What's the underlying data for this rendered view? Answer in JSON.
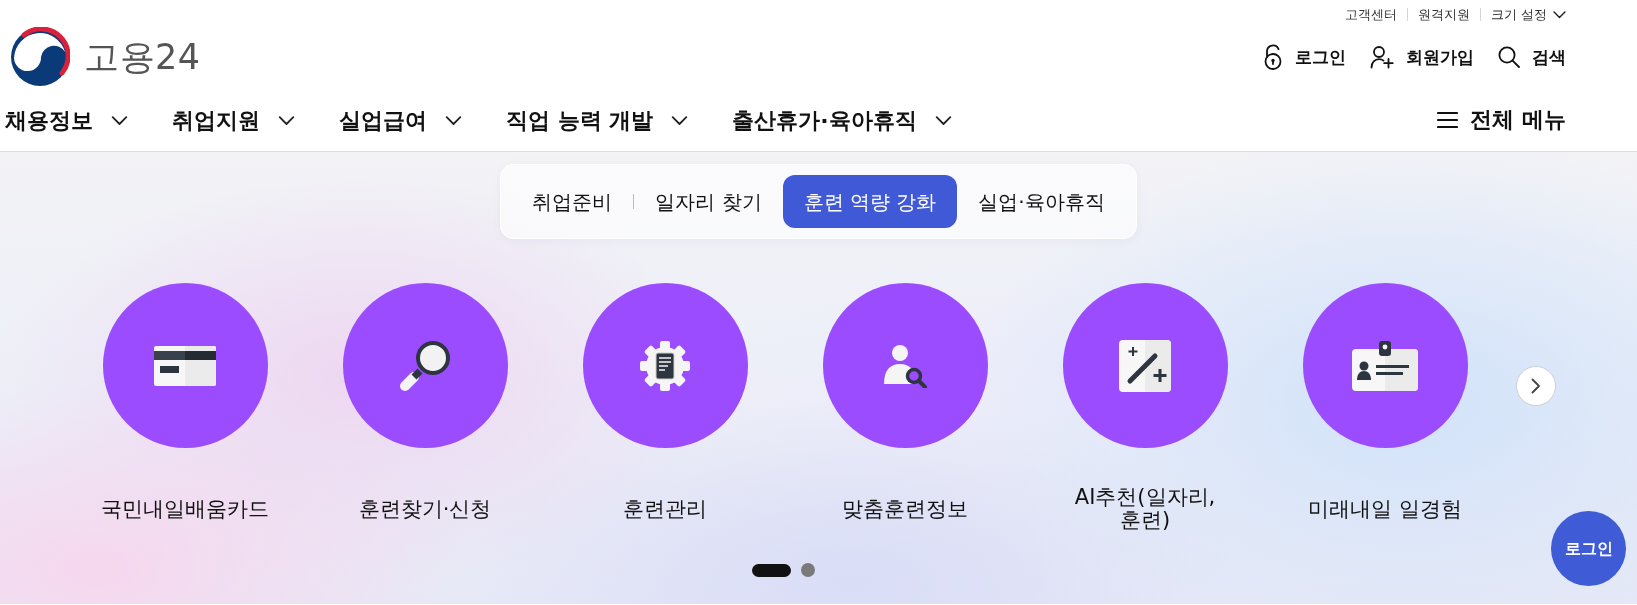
{
  "utility_links": [
    {
      "label": "고객센터",
      "kind": "link"
    },
    {
      "label": "원격지원",
      "kind": "link"
    },
    {
      "label": "크기 설정",
      "kind": "dropdown"
    }
  ],
  "logo": {
    "text": "고용24"
  },
  "account_links": [
    {
      "label": "로그인",
      "kind": "login"
    },
    {
      "label": "회원가입",
      "kind": "signup"
    },
    {
      "label": "검색",
      "kind": "search"
    }
  ],
  "main_menu": [
    {
      "label": "채용정보"
    },
    {
      "label": "취업지원"
    },
    {
      "label": "실업급여"
    },
    {
      "label": "직업 능력 개발"
    },
    {
      "label": "출산휴가·육아휴직"
    }
  ],
  "all_menu_button": {
    "label": "전체 메뉴"
  },
  "category_tabs": [
    {
      "label": "취업준비",
      "selected": false
    },
    {
      "label": "일자리 찾기",
      "selected": false
    },
    {
      "label": "훈련 역량 강화",
      "selected": true
    },
    {
      "label": "실업·육아휴직",
      "selected": false
    }
  ],
  "services": [
    {
      "label": "국민내일배움카드",
      "kind": "card"
    },
    {
      "label": "훈련찾기·신청",
      "kind": "magnifier"
    },
    {
      "label": "훈련관리",
      "kind": "gear"
    },
    {
      "label": "맞춤훈련정보",
      "kind": "person_search"
    },
    {
      "label": "AI추천(일자리, 훈련)",
      "kind": "wand"
    },
    {
      "label": "미래내일 일경험",
      "kind": "badge"
    }
  ],
  "pagination": [
    {
      "selected": true
    },
    {
      "selected": false
    }
  ],
  "floating_button": {
    "label": "로그인"
  }
}
